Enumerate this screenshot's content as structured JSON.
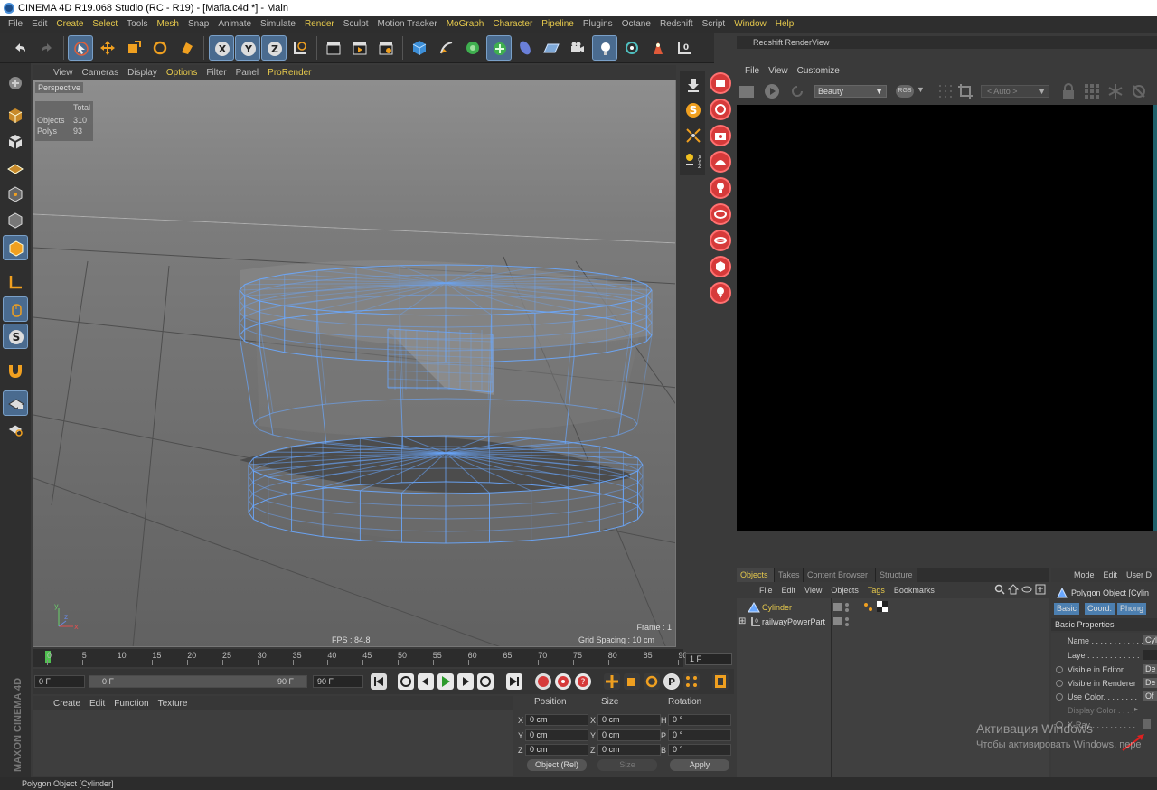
{
  "titlebar": {
    "title": "CINEMA 4D R19.068 Studio (RC - R19) - [Mafia.c4d *] - Main"
  },
  "menubar": [
    "File",
    "Edit",
    "Create",
    "Select",
    "Tools",
    "Mesh",
    "Snap",
    "Animate",
    "Simulate",
    "Render",
    "Sculpt",
    "Motion Tracker",
    "MoGraph",
    "Character",
    "Pipeline",
    "Plugins",
    "Octane",
    "Redshift",
    "Script",
    "Window",
    "Help"
  ],
  "viewport": {
    "menu": [
      "View",
      "Cameras",
      "Display",
      "Options",
      "Filter",
      "Panel",
      "ProRender"
    ],
    "label": "Perspective",
    "stats": {
      "header": "Total",
      "objects_label": "Objects",
      "objects_value": "310",
      "polys_label": "Polys",
      "polys_value": "93"
    },
    "fps": "FPS : 84.8",
    "grid_spacing": "Grid Spacing : 10 cm",
    "frame": "Frame : 1",
    "axis_x": "x",
    "axis_y": "y",
    "axis_z": "z",
    "wire_color": "#6aa8ff"
  },
  "timeline": {
    "ticks": [
      "0",
      "5",
      "10",
      "15",
      "20",
      "25",
      "30",
      "35",
      "40",
      "45",
      "50",
      "55",
      "60",
      "65",
      "70",
      "75",
      "80",
      "85",
      "90"
    ],
    "end": "1 F"
  },
  "transport": {
    "start": "0 F",
    "current": "0 F",
    "slider_end": "90 F",
    "end": "90 F"
  },
  "material": {
    "menu": [
      "Create",
      "Edit",
      "Function",
      "Texture"
    ]
  },
  "coords": {
    "headers": [
      "Position",
      "Size",
      "Rotation"
    ],
    "rows": [
      {
        "a1": "X",
        "v1": "0 cm",
        "a2": "X",
        "v2": "0 cm",
        "a3": "H",
        "v3": "0 °"
      },
      {
        "a1": "Y",
        "v1": "0 cm",
        "a2": "Y",
        "v2": "0 cm",
        "a3": "P",
        "v3": "0 °"
      },
      {
        "a1": "Z",
        "v1": "0 cm",
        "a2": "Z",
        "v2": "0 cm",
        "a3": "B",
        "v3": "0 °"
      }
    ],
    "mode": "Object (Rel)",
    "size_mode": "Size",
    "apply": "Apply"
  },
  "maxon": "MAXON CINEMA 4D",
  "status": "Polygon Object [Cylinder]",
  "renderview": {
    "title": "Redshift RenderView",
    "menu": [
      "File",
      "View",
      "Customize"
    ],
    "aov": "Beauty",
    "rgb": "RGB",
    "auto": "< Auto >"
  },
  "objects": {
    "tabs": [
      "Objects",
      "Takes",
      "Content Browser",
      "Structure"
    ],
    "menu": [
      "File",
      "Edit",
      "View",
      "Objects",
      "Tags",
      "Bookmarks"
    ],
    "items": [
      {
        "name": "Cylinder",
        "selected": true
      },
      {
        "name": "railwayPowerPart",
        "selected": false
      }
    ]
  },
  "attributes": {
    "menu": [
      "Mode",
      "Edit",
      "User D"
    ],
    "title": "Polygon Object [Cylin",
    "tabs": [
      "Basic",
      "Coord.",
      "Phong"
    ],
    "section": "Basic Properties",
    "props": [
      {
        "label": "Name . . . . . . . . . . . .",
        "value": "Cyl"
      },
      {
        "label": "Layer. . . . . . . . . . . .",
        "value": ""
      },
      {
        "label": "Visible in Editor. . .",
        "value": "De"
      },
      {
        "label": "Visible in Renderer",
        "value": "De"
      },
      {
        "label": "Use Color. . . . . . . .",
        "value": "Of"
      },
      {
        "label": "Display Color . . . .",
        "value": ""
      },
      {
        "label": "X-Ray . . . . . . . . . .",
        "value": ""
      }
    ]
  },
  "watermark": {
    "line1": "Активация Windows",
    "line2": "Чтобы активировать Windows, пере"
  }
}
